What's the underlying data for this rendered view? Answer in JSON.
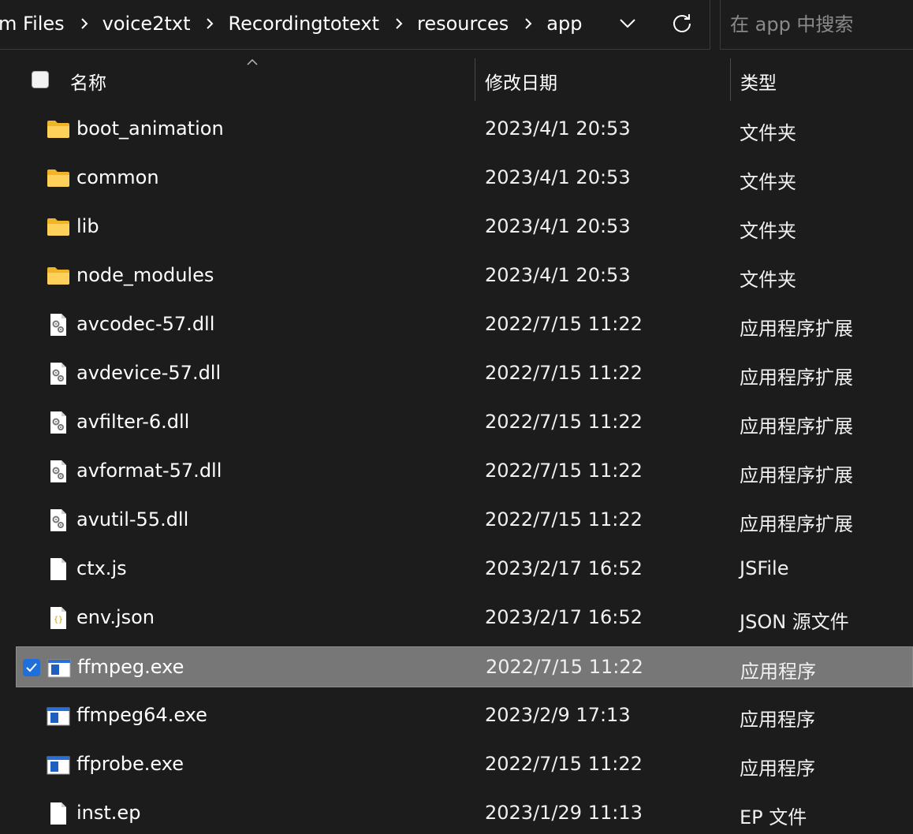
{
  "breadcrumb": [
    "m Files",
    "voice2txt",
    "Recordingtotext",
    "resources",
    "app"
  ],
  "search": {
    "placeholder": "在 app 中搜索"
  },
  "columns": {
    "name": "名称",
    "date": "修改日期",
    "type": "类型"
  },
  "files": [
    {
      "name": "boot_animation",
      "date": "2023/4/1 20:53",
      "type": "文件夹",
      "icon": "folder-icon"
    },
    {
      "name": "common",
      "date": "2023/4/1 20:53",
      "type": "文件夹",
      "icon": "folder-icon"
    },
    {
      "name": "lib",
      "date": "2023/4/1 20:53",
      "type": "文件夹",
      "icon": "folder-icon"
    },
    {
      "name": "node_modules",
      "date": "2023/4/1 20:53",
      "type": "文件夹",
      "icon": "folder-icon"
    },
    {
      "name": "avcodec-57.dll",
      "date": "2022/7/15 11:22",
      "type": "应用程序扩展",
      "icon": "dll-file-icon"
    },
    {
      "name": "avdevice-57.dll",
      "date": "2022/7/15 11:22",
      "type": "应用程序扩展",
      "icon": "dll-file-icon"
    },
    {
      "name": "avfilter-6.dll",
      "date": "2022/7/15 11:22",
      "type": "应用程序扩展",
      "icon": "dll-file-icon"
    },
    {
      "name": "avformat-57.dll",
      "date": "2022/7/15 11:22",
      "type": "应用程序扩展",
      "icon": "dll-file-icon"
    },
    {
      "name": "avutil-55.dll",
      "date": "2022/7/15 11:22",
      "type": "应用程序扩展",
      "icon": "dll-file-icon"
    },
    {
      "name": "ctx.js",
      "date": "2023/2/17 16:52",
      "type": "JSFile",
      "icon": "blank-file-icon"
    },
    {
      "name": "env.json",
      "date": "2023/2/17 16:52",
      "type": "JSON 源文件",
      "icon": "json-file-icon"
    },
    {
      "name": "ffmpeg.exe",
      "date": "2022/7/15 11:22",
      "type": "应用程序",
      "icon": "exe-file-icon",
      "selected": true
    },
    {
      "name": "ffmpeg64.exe",
      "date": "2023/2/9 17:13",
      "type": "应用程序",
      "icon": "exe-file-icon"
    },
    {
      "name": "ffprobe.exe",
      "date": "2022/7/15 11:22",
      "type": "应用程序",
      "icon": "exe-file-icon"
    },
    {
      "name": "inst.ep",
      "date": "2023/1/29 11:13",
      "type": "EP 文件",
      "icon": "blank-file-icon"
    }
  ],
  "colors": {
    "selection": "#777777",
    "checkbox": "#1e6fd9",
    "folder": "#f5c542"
  }
}
